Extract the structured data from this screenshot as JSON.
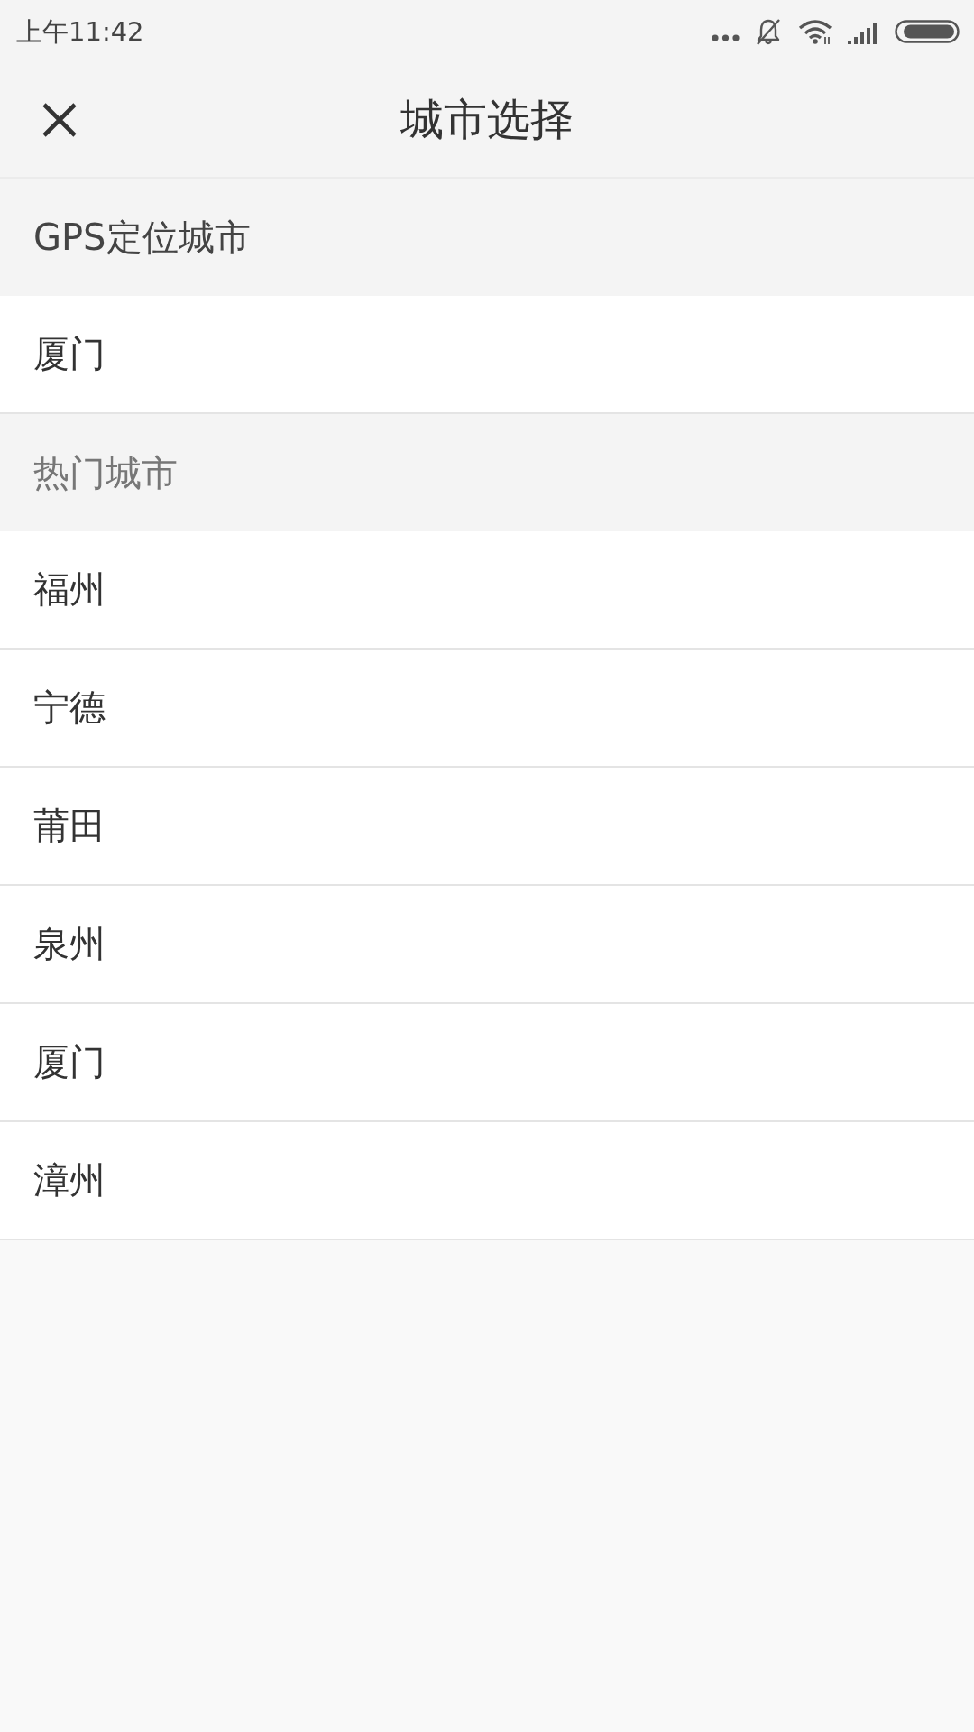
{
  "status_bar": {
    "time": "上午11:42"
  },
  "header": {
    "title": "城市选择"
  },
  "sections": [
    {
      "kind": "gps",
      "title": "GPS定位城市",
      "cities": [
        {
          "name": "厦门"
        }
      ]
    },
    {
      "kind": "hot",
      "title": "热门城市",
      "cities": [
        {
          "name": "福州"
        },
        {
          "name": "宁德"
        },
        {
          "name": "莆田"
        },
        {
          "name": "泉州"
        },
        {
          "name": "厦门"
        },
        {
          "name": "漳州"
        }
      ]
    }
  ]
}
